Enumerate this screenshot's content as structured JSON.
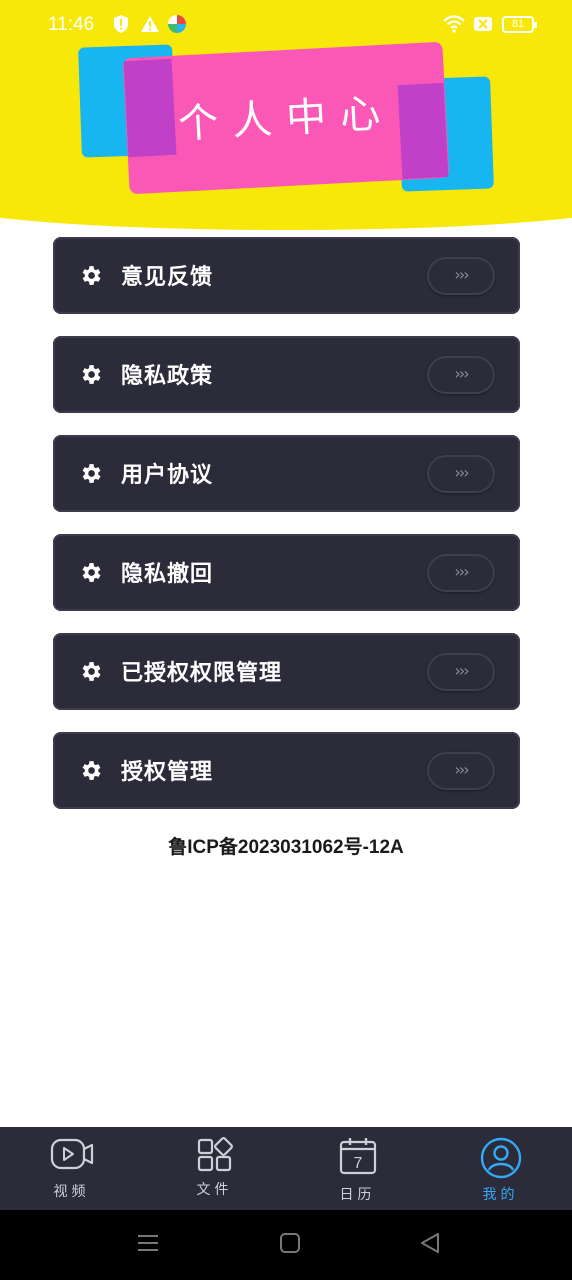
{
  "status_bar": {
    "time": "11:46",
    "battery": "81"
  },
  "header": {
    "title": "个人中心"
  },
  "menu": {
    "items": [
      {
        "label": "意见反馈",
        "arrow": "›››"
      },
      {
        "label": "隐私政策",
        "arrow": "›››"
      },
      {
        "label": "用户协议",
        "arrow": "›››"
      },
      {
        "label": "隐私撤回",
        "arrow": "›››"
      },
      {
        "label": "已授权权限管理",
        "arrow": "›››"
      },
      {
        "label": "授权管理",
        "arrow": "›››"
      }
    ]
  },
  "footer": {
    "icp": "鲁ICP备2023031062号-12A"
  },
  "tabbar": {
    "tabs": [
      {
        "label": "视频",
        "icon": "video-icon"
      },
      {
        "label": "文件",
        "icon": "grid-icon"
      },
      {
        "label": "日历",
        "icon": "calendar-icon",
        "day": "7"
      },
      {
        "label": "我的",
        "icon": "user-icon",
        "active": true
      }
    ]
  },
  "colors": {
    "header_bg": "#f7e80a",
    "pink": "#fa58b6",
    "blue": "#17b6f0",
    "menu_bg": "#2b2b3a",
    "active": "#34a9f5"
  }
}
